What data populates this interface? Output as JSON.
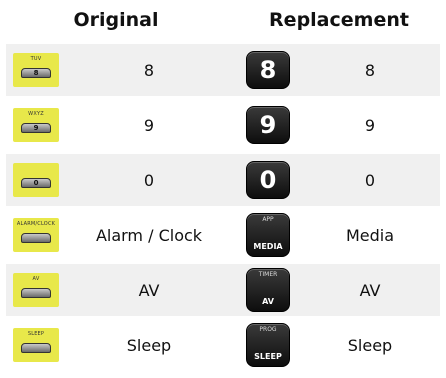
{
  "headers": {
    "original": "Original",
    "replacement": "Replacement"
  },
  "rows": [
    {
      "orig_key_label": "TUV",
      "orig_key_num": "8",
      "orig_text": "8",
      "repl_type": "big",
      "repl_main": "8",
      "repl_top": "",
      "repl_text": "8"
    },
    {
      "orig_key_label": "WXYZ",
      "orig_key_num": "9",
      "orig_text": "9",
      "repl_type": "big",
      "repl_main": "9",
      "repl_top": "",
      "repl_text": "9"
    },
    {
      "orig_key_label": "",
      "orig_key_num": "0",
      "orig_text": "0",
      "repl_type": "big",
      "repl_main": "0",
      "repl_top": "",
      "repl_text": "0"
    },
    {
      "orig_key_label": "ALARM/CLOCK",
      "orig_key_num": "",
      "orig_text": "Alarm / Clock",
      "repl_type": "sub",
      "repl_main": "MEDIA",
      "repl_top": "APP",
      "repl_text": "Media"
    },
    {
      "orig_key_label": "AV",
      "orig_key_num": "",
      "orig_text": "AV",
      "repl_type": "sub",
      "repl_main": "AV",
      "repl_top": "TIMER",
      "repl_text": "AV"
    },
    {
      "orig_key_label": "SLEEP",
      "orig_key_num": "",
      "orig_text": "Sleep",
      "repl_type": "sub",
      "repl_main": "SLEEP",
      "repl_top": "PROG",
      "repl_text": "Sleep"
    }
  ],
  "colors": {
    "yellow": "#e8e84a",
    "dark": "#1a1a1a",
    "stripe": "#f0f0f0"
  }
}
